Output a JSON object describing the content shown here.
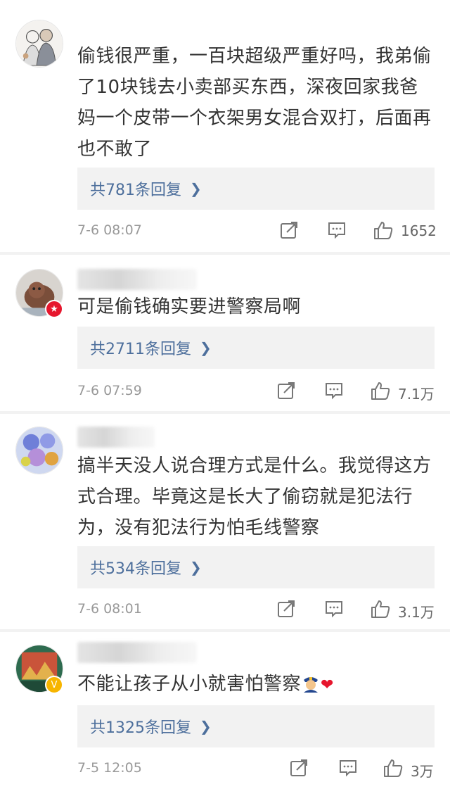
{
  "comments": [
    {
      "text": "偷钱很严重，一百块超级严重好吗，我弟偷了10块钱去小卖部买东西，深夜回家我爸妈一个皮带一个衣架男女混合双打，后面再也不敢了",
      "replies_label": "共781条回复",
      "time": "7-6 08:07",
      "likes": "1652",
      "badge": "none",
      "avatar_icon": "sketch-avatar"
    },
    {
      "text": "可是偷钱确实要进警察局啊",
      "replies_label": "共2711条回复",
      "time": "7-6 07:59",
      "likes": "7.1万",
      "badge": "red-star",
      "avatar_icon": "dog-avatar"
    },
    {
      "text": "搞半天没人说合理方式是什么。我觉得这方式合理。毕竟这是长大了偷窃就是犯法行为，没有犯法行为怕毛线警察",
      "replies_label": "共534条回复",
      "time": "7-6 08:01",
      "likes": "3.1万",
      "badge": "none",
      "avatar_icon": "flowers-avatar"
    },
    {
      "text": "不能让孩子从小就害怕警察",
      "replies_label": "共1325条回复",
      "time": "7-5 12:05",
      "likes": "3万",
      "badge": "gold-v",
      "avatar_icon": "painting-avatar"
    }
  ],
  "icons": {
    "repost": "repost-icon",
    "comment": "comment-icon",
    "like": "like-icon",
    "chevron": "chevron-right-icon"
  },
  "colors": {
    "link": "#4d6f9c",
    "muted": "#999999",
    "reply_bg": "#f2f2f2"
  }
}
